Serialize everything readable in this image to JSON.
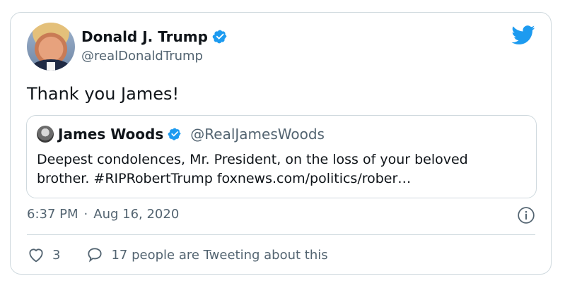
{
  "tweet": {
    "author": {
      "display_name": "Donald J. Trump",
      "handle": "@realDonaldTrump",
      "verified": true
    },
    "text": "Thank you James!",
    "quoted_tweet": {
      "display_name": "James Woods",
      "handle": "@RealJamesWoods",
      "verified": true,
      "text": "Deepest condolences, Mr. President, on the loss of your beloved brother. #RIPRobertTrump  foxnews.com/politics/rober…"
    },
    "time": "6:37 PM",
    "separator": "·",
    "date": "Aug 16, 2020",
    "likes": "3",
    "tweeting_text": "17 people are Tweeting about this"
  },
  "colors": {
    "brand_blue": "#1d9bf0",
    "secondary_text": "#536471",
    "border": "#cfd9de"
  },
  "icons": [
    "verified-badge-icon",
    "twitter-bird-icon",
    "info-icon",
    "heart-icon",
    "speech-bubble-icon"
  ]
}
